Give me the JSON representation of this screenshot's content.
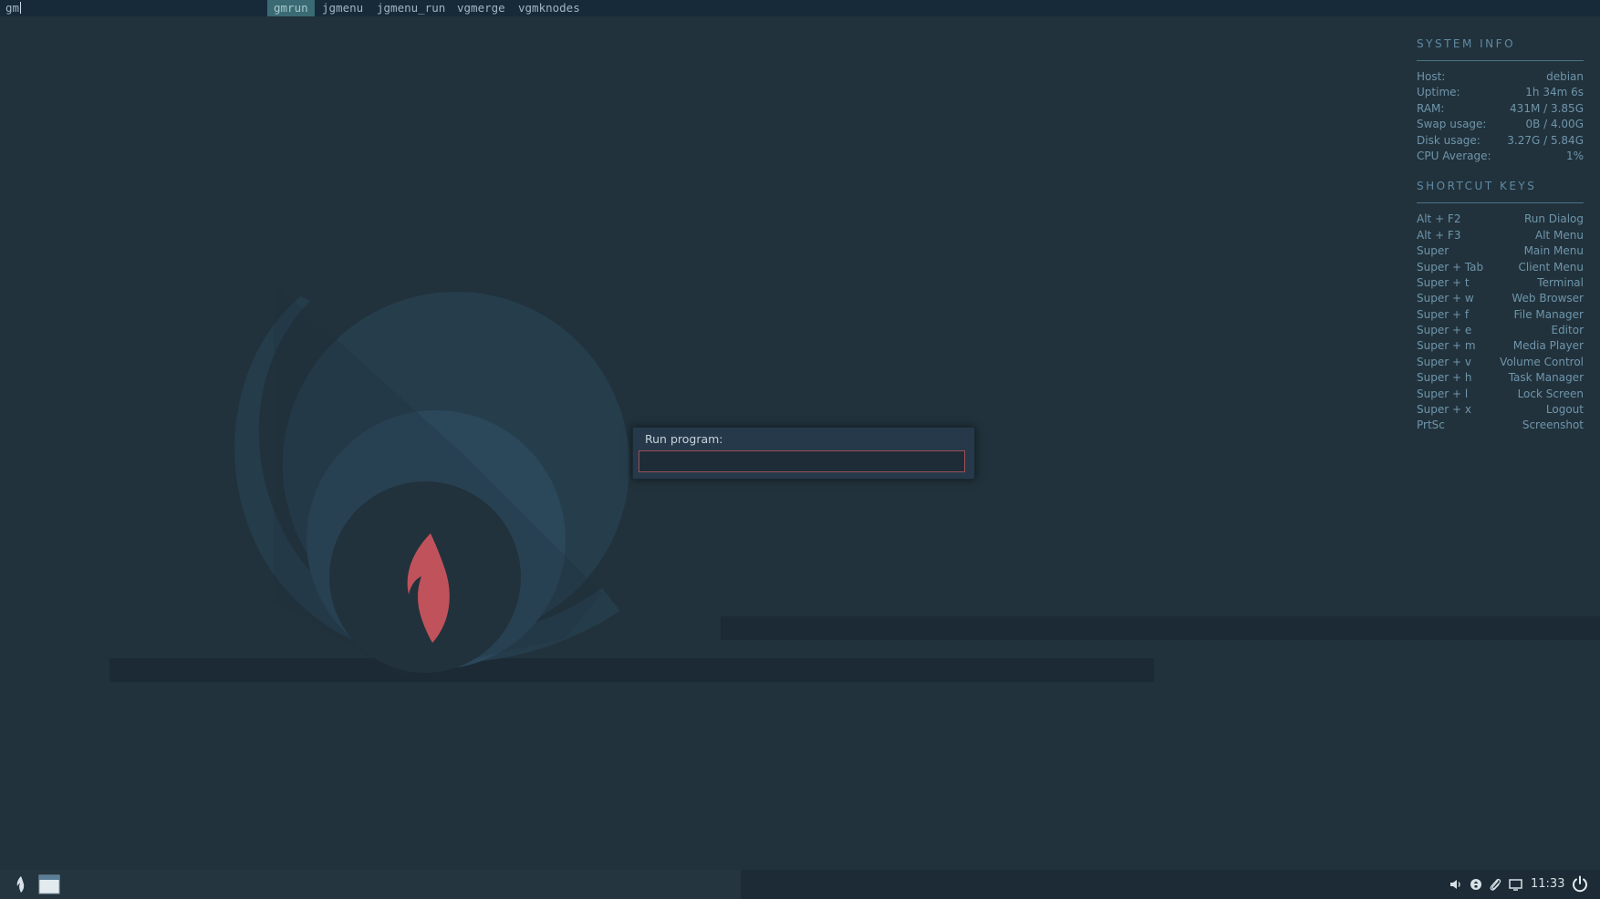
{
  "dmenu": {
    "prompt": "gm",
    "items": [
      {
        "label": "gmrun",
        "selected": true
      },
      {
        "label": "jgmenu",
        "selected": false
      },
      {
        "label": "jgmenu_run",
        "selected": false
      },
      {
        "label": "vgmerge",
        "selected": false
      },
      {
        "label": "vgmknodes",
        "selected": false
      }
    ]
  },
  "run_dialog": {
    "label": "Run program:",
    "value": ""
  },
  "conky": {
    "system_info": {
      "title": "SYSTEM INFO",
      "rows": [
        {
          "key": "Host:",
          "value": "debian"
        },
        {
          "key": "Uptime:",
          "value": "1h 34m 6s"
        },
        {
          "key": "RAM:",
          "value": "431M / 3.85G"
        },
        {
          "key": "Swap usage:",
          "value": "0B / 4.00G"
        },
        {
          "key": "Disk usage:",
          "value": "3.27G / 5.84G"
        },
        {
          "key": "CPU Average:",
          "value": "1%"
        }
      ]
    },
    "shortcut_keys": {
      "title": "SHORTCUT KEYS",
      "rows": [
        {
          "key": "Alt + F2",
          "value": "Run Dialog"
        },
        {
          "key": "Alt + F3",
          "value": "Alt Menu"
        },
        {
          "key": "Super",
          "value": "Main Menu"
        },
        {
          "key": "Super + Tab",
          "value": "Client Menu"
        },
        {
          "key": "Super + t",
          "value": "Terminal"
        },
        {
          "key": "Super + w",
          "value": "Web Browser"
        },
        {
          "key": "Super + f",
          "value": "File Manager"
        },
        {
          "key": "Super + e",
          "value": "Editor"
        },
        {
          "key": "Super + m",
          "value": "Media Player"
        },
        {
          "key": "Super + v",
          "value": "Volume Control"
        },
        {
          "key": "Super + h",
          "value": "Task Manager"
        },
        {
          "key": "Super + l",
          "value": "Lock Screen"
        },
        {
          "key": "Super + x",
          "value": "Logout"
        },
        {
          "key": "PrtSc",
          "value": "Screenshot"
        }
      ]
    }
  },
  "panel": {
    "clock": "11:33",
    "left_icons": [
      "flame-menu-icon",
      "window-task-icon"
    ],
    "tray_icons": [
      "volume-icon",
      "network-icon",
      "clipboard-icon",
      "display-icon",
      "power-icon"
    ]
  },
  "colors": {
    "background": "#21323c",
    "accent_flame": "#c0525b",
    "selection": "#3a6a73"
  }
}
